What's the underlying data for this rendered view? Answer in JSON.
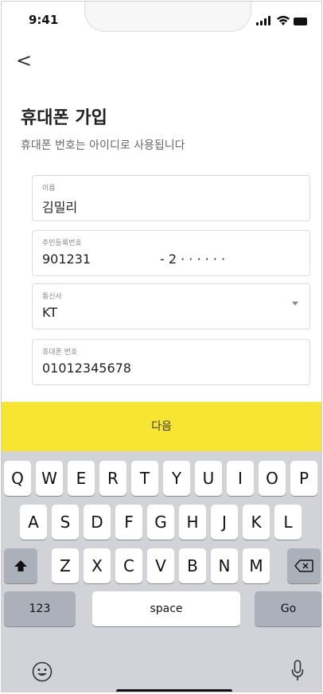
{
  "status_bar": {
    "time": "9:41"
  },
  "header": {
    "back_icon": "chevron-left-icon",
    "back_glyph": "<"
  },
  "page": {
    "title": "휴대폰 가입",
    "subtitle": "휴대폰 번호는 아이디로 사용됩니다"
  },
  "form": {
    "name": {
      "label": "이름",
      "value": "김밀리"
    },
    "rrn": {
      "label": "주민등록번호",
      "front": "901231",
      "back": "- 2 · · · · · ·"
    },
    "carrier": {
      "label": "통신사",
      "value": "KT",
      "icon": "caret-down-icon"
    },
    "phone": {
      "label": "휴대폰 번호",
      "value": "01012345678"
    }
  },
  "next_button": {
    "label": "다음",
    "color": "#f8e533"
  },
  "keyboard": {
    "row1": [
      "Q",
      "W",
      "E",
      "R",
      "T",
      "Y",
      "U",
      "I",
      "O",
      "P"
    ],
    "row2": [
      "A",
      "S",
      "D",
      "F",
      "G",
      "H",
      "J",
      "K",
      "L"
    ],
    "row3": [
      "Z",
      "X",
      "C",
      "V",
      "B",
      "N",
      "M"
    ],
    "shift_icon": "shift-icon",
    "delete_icon": "backspace-icon",
    "numbers_label": "123",
    "space_label": "space",
    "go_label": "Go",
    "emoji_icon": "emoji-icon",
    "mic_icon": "microphone-icon",
    "background": "#d1d3d9"
  }
}
